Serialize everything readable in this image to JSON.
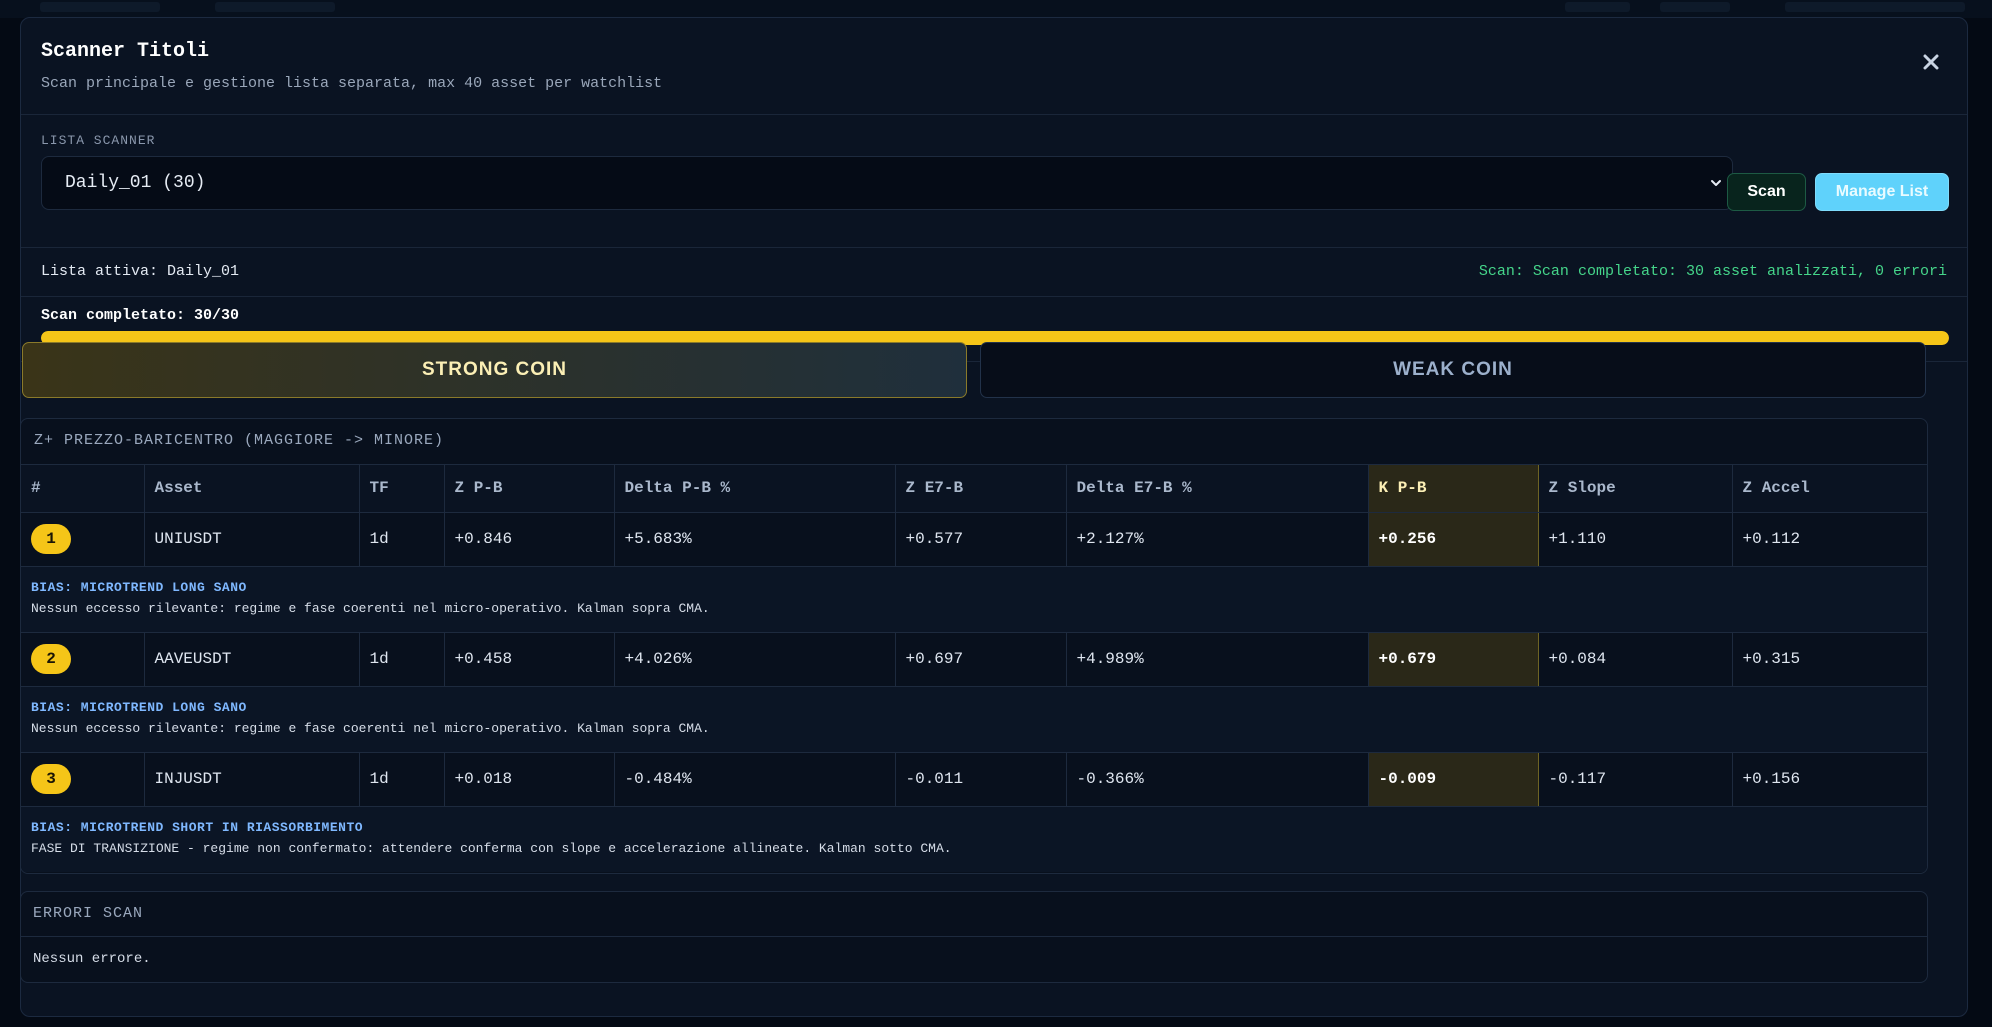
{
  "modal": {
    "title": "Scanner Titoli",
    "subtitle": "Scan principale e gestione lista separata, max 40 asset per watchlist"
  },
  "scanner_list": {
    "label": "LISTA SCANNER",
    "selected": "Daily_01 (30)",
    "scan_button": "Scan",
    "manage_button": "Manage List"
  },
  "status": {
    "active_list": "Lista attiva: Daily_01",
    "scan_message": "Scan: Scan completato: 30 asset analizzati, 0 errori"
  },
  "progress": {
    "label": "Scan completato: 30/30",
    "value": 1.0
  },
  "tabs": {
    "strong": "STRONG COIN",
    "weak": "WEAK COIN"
  },
  "results": {
    "title": "Z+ PREZZO-BARICENTRO (MAGGIORE -> MINORE)",
    "columns": [
      "#",
      "Asset",
      "TF",
      "Z P-B",
      "Delta P-B %",
      "Z E7-B",
      "Delta E7-B %",
      "K P-B",
      "Z Slope",
      "Z Accel"
    ],
    "rows": [
      {
        "rank": "1",
        "asset": "UNIUSDT",
        "tf": "1d",
        "z_pb": "+0.846",
        "delta_pb": "+5.683%",
        "z_e7b": "+0.577",
        "delta_e7b": "+2.127%",
        "k_pb": "+0.256",
        "z_slope": "+1.110",
        "z_accel": "+0.112",
        "bias_title": "BIAS: MICROTREND LONG SANO",
        "bias_desc": "Nessun eccesso rilevante: regime e fase coerenti nel micro-operativo. Kalman sopra CMA."
      },
      {
        "rank": "2",
        "asset": "AAVEUSDT",
        "tf": "1d",
        "z_pb": "+0.458",
        "delta_pb": "+4.026%",
        "z_e7b": "+0.697",
        "delta_e7b": "+4.989%",
        "k_pb": "+0.679",
        "z_slope": "+0.084",
        "z_accel": "+0.315",
        "bias_title": "BIAS: MICROTREND LONG SANO",
        "bias_desc": "Nessun eccesso rilevante: regime e fase coerenti nel micro-operativo. Kalman sopra CMA."
      },
      {
        "rank": "3",
        "asset": "INJUSDT",
        "tf": "1d",
        "z_pb": "+0.018",
        "delta_pb": "-0.484%",
        "z_e7b": "-0.011",
        "delta_e7b": "-0.366%",
        "k_pb": "-0.009",
        "z_slope": "-0.117",
        "z_accel": "+0.156",
        "bias_title": "BIAS: MICROTREND SHORT IN RIASSORBIMENTO",
        "bias_desc": "FASE DI TRANSIZIONE - regime non confermato: attendere conferma con slope e accelerazione allineate. Kalman sotto CMA."
      }
    ]
  },
  "errors": {
    "title": "ERRORI SCAN",
    "body": "Nessun errore."
  },
  "colors": {
    "accent_yellow": "#f5c518",
    "accent_cyan": "#5fd2fb",
    "success_green": "#45d58a",
    "bias_blue": "#7fb8ff",
    "background": "#0a1322"
  },
  "icons": {
    "close": "close-icon",
    "dropdown": "chevron-down-icon"
  }
}
